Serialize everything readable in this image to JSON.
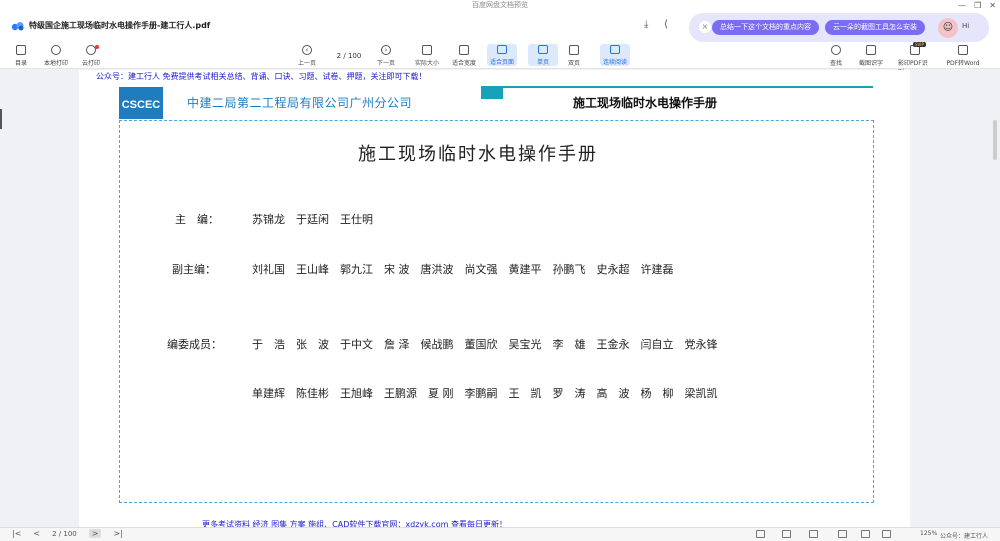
{
  "window": {
    "title": "百度网盘文档预览",
    "min": "—",
    "max": "❐",
    "close": "✕"
  },
  "header": {
    "file_name": "特级国企施工现场临时水电操作手册-建工行人.pdf",
    "download_icon": "download-icon",
    "share_icon": "share-icon"
  },
  "ai_bar": {
    "close": "×",
    "pill1": "总结一下这个文档的重点内容",
    "pill2": "云一朵的截图工具怎么安装",
    "greeting": "Hi"
  },
  "toolbar": {
    "catalog": "目录",
    "local_print": "本地打印",
    "cloud_print": "云打印",
    "prev": "上一页",
    "page_value": "2",
    "page_total": "/ 100",
    "next": "下一页",
    "actual_size": "实际大小",
    "fit_width": "适合宽度",
    "fit_page": "适合页面",
    "single": "单页",
    "double": "双页",
    "continuous": "连续阅读",
    "find": "查找",
    "ocr": "截图识字",
    "pdf_ocr": "影印PDF识别",
    "svip": "SVIP",
    "pdf_word": "PDF转Word"
  },
  "page": {
    "ad_top": "公众号：建工行人 免费提供考试相关总结、背诵、口诀、习题、试卷、押题，关注即可下载！",
    "company_name": "中建二局第二工程局有限公司广州分公司",
    "manual_header": "施工现场临时水电操作手册",
    "doc_title": "施工现场临时水电操作手册",
    "editor_label": "主　编：",
    "editors": "苏锦龙　于廷闲　王仕明",
    "deputy_label": "副主编：",
    "deputies": "刘礼国　王山峰　郭九江　宋 波　唐洪波　尚文强　黄建平　孙鹏飞　史永超　许建磊",
    "members_label": "编委成员：",
    "members_row1": "于　浩　张　波　于中文　詹 泽　候战鹏　董国欣　吴宝光　李　雄　王金永　闫自立　党永锋",
    "members_row2": "单建辉　陈佳彬　王旭峰　王鹏源　夏 刚　李鹏嗣　王　凯　罗　涛　高　波　杨　柳　梁凯凯",
    "ad_bottom": "更多考试资料 经济 图集 方案 施组、CAD软件下载官网：xdzyk.com 查看每日更新！"
  },
  "status": {
    "first": "|<",
    "prev": "<",
    "page": "2 / 100",
    "next": ">",
    "last": ">|",
    "zoom": "125%",
    "watermark": "公众号：建工行人"
  }
}
